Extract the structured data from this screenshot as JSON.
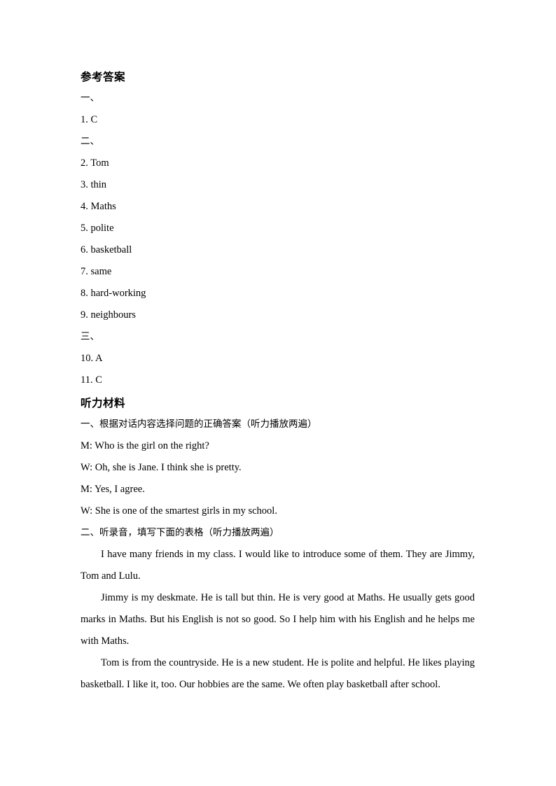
{
  "document": {
    "answer_key_heading": "参考答案",
    "listening_material_heading": "听力材料",
    "sections": {
      "part_one_marker": "一、",
      "part_two_marker": "二、",
      "part_three_marker": "三、"
    },
    "answers": [
      "1. C",
      "2. Tom",
      "3. thin",
      "4. Maths",
      "5. polite",
      "6. basketball",
      "7. same",
      "8. hard-working",
      "9. neighbours",
      "10. A",
      "11. C"
    ],
    "listening": {
      "task_one_heading": "一、根据对话内容选择问题的正确答案（听力播放两遍）",
      "dialogue": [
        "M: Who is the girl on the right?",
        "W: Oh, she is Jane. I think she is pretty.",
        "M: Yes, I agree.",
        "W: She is one of the smartest girls in my school."
      ],
      "task_two_heading": "二、听录音，填写下面的表格（听力播放两遍）",
      "paragraphs": [
        "I have many friends in my class. I would like to introduce some of them. They are Jimmy, Tom and Lulu.",
        "Jimmy is my deskmate. He is tall but thin. He is very good at Maths. He usually gets good marks in Maths. But his English is not so good. So I help him with his English and he helps me with Maths.",
        "Tom is from the countryside. He is a new student. He is polite and helpful. He likes playing basketball. I like it, too. Our hobbies are the same. We often play basketball after school."
      ]
    }
  }
}
